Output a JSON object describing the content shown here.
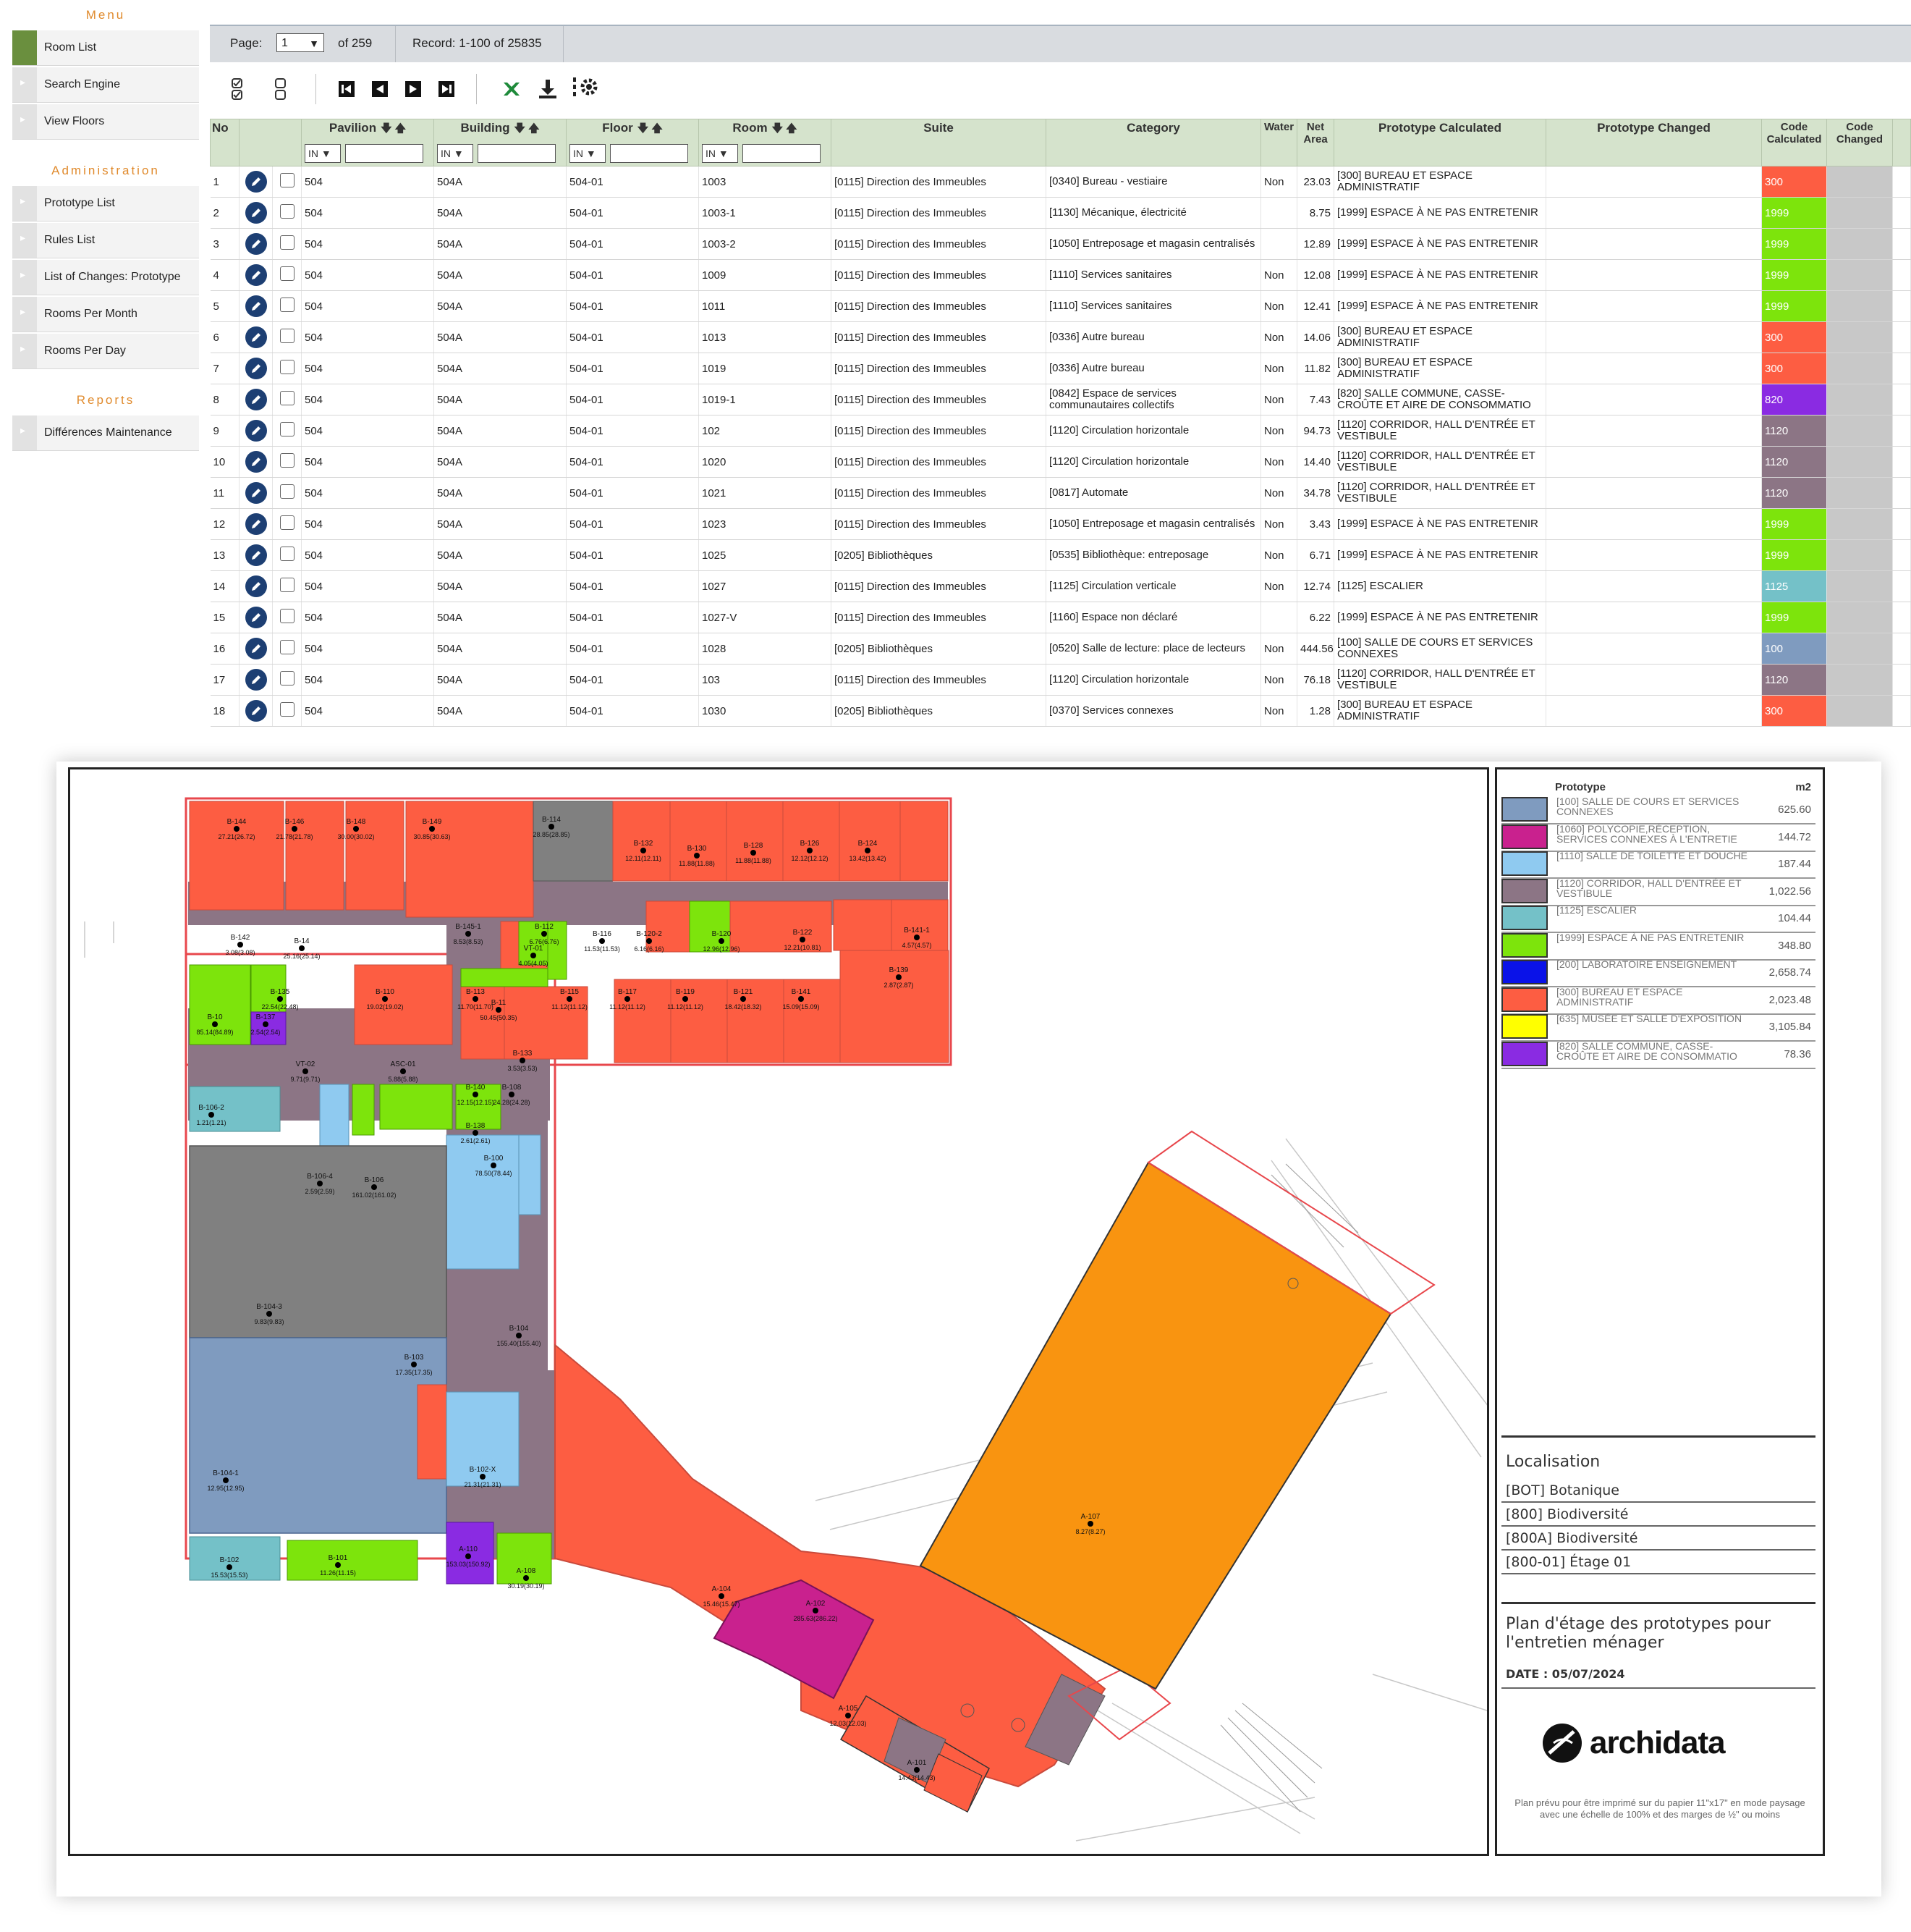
{
  "menu": {
    "heading": "Menu",
    "items": [
      {
        "label": "Room List"
      },
      {
        "label": "Search Engine"
      },
      {
        "label": "View Floors"
      }
    ],
    "admin_heading": "Administration",
    "admin_items": [
      {
        "label": "Prototype List"
      },
      {
        "label": "Rules List"
      },
      {
        "label": "List of Changes: Prototype"
      },
      {
        "label": "Rooms Per Month"
      },
      {
        "label": "Rooms Per Day"
      }
    ],
    "reports_heading": "Reports",
    "reports_items": [
      {
        "label": "Différences Maintenance"
      }
    ]
  },
  "pager": {
    "page_label": "Page:",
    "page_value": "1",
    "of_label": "of 259",
    "record_label": "Record: 1-100 of 25835"
  },
  "toolbar": {
    "icons": [
      "check-all-icon",
      "uncheck-all-icon",
      "first-page-icon",
      "prev-page-icon",
      "next-page-icon",
      "last-page-icon",
      "excel-export-icon",
      "download-icon",
      "column-settings-icon"
    ]
  },
  "table": {
    "headers": {
      "no": "No",
      "pavilion": "Pavilion",
      "building": "Building",
      "floor": "Floor",
      "room": "Room",
      "suite": "Suite",
      "category": "Category",
      "water": "Water",
      "net_area": "Net Area",
      "proto_calc": "Prototype Calculated",
      "proto_changed": "Prototype Changed",
      "code_calc": "Code Calculated",
      "code_changed": "Code Changed"
    },
    "filter_op": "IN",
    "rows": [
      {
        "no": "1",
        "pav": "504",
        "bld": "504A",
        "floor": "504-01",
        "room": "1003",
        "suite": "[0115] Direction des Immeubles",
        "cat": "[0340] Bureau - vestiaire",
        "water": "Non",
        "area": "23.03",
        "proto": "[300] BUREAU ET ESPACE ADMINISTRATIF",
        "code": "300",
        "color": "#fd5d42"
      },
      {
        "no": "2",
        "pav": "504",
        "bld": "504A",
        "floor": "504-01",
        "room": "1003-1",
        "suite": "[0115] Direction des Immeubles",
        "cat": "[1130] Mécanique, électricité",
        "water": "",
        "area": "8.75",
        "proto": "[1999] ESPACE À NE PAS ENTRETENIR",
        "code": "1999",
        "color": "#7de40c"
      },
      {
        "no": "3",
        "pav": "504",
        "bld": "504A",
        "floor": "504-01",
        "room": "1003-2",
        "suite": "[0115] Direction des Immeubles",
        "cat": "[1050] Entreposage et magasin centralisés",
        "water": "",
        "area": "12.89",
        "proto": "[1999] ESPACE À NE PAS ENTRETENIR",
        "code": "1999",
        "color": "#7de40c"
      },
      {
        "no": "4",
        "pav": "504",
        "bld": "504A",
        "floor": "504-01",
        "room": "1009",
        "suite": "[0115] Direction des Immeubles",
        "cat": "[1110] Services sanitaires",
        "water": "Non",
        "area": "12.08",
        "proto": "[1999] ESPACE À NE PAS ENTRETENIR",
        "code": "1999",
        "color": "#7de40c"
      },
      {
        "no": "5",
        "pav": "504",
        "bld": "504A",
        "floor": "504-01",
        "room": "1011",
        "suite": "[0115] Direction des Immeubles",
        "cat": "[1110] Services sanitaires",
        "water": "Non",
        "area": "12.41",
        "proto": "[1999] ESPACE À NE PAS ENTRETENIR",
        "code": "1999",
        "color": "#7de40c"
      },
      {
        "no": "6",
        "pav": "504",
        "bld": "504A",
        "floor": "504-01",
        "room": "1013",
        "suite": "[0115] Direction des Immeubles",
        "cat": "[0336] Autre bureau",
        "water": "Non",
        "area": "14.06",
        "proto": "[300] BUREAU ET ESPACE ADMINISTRATIF",
        "code": "300",
        "color": "#fd5d42"
      },
      {
        "no": "7",
        "pav": "504",
        "bld": "504A",
        "floor": "504-01",
        "room": "1019",
        "suite": "[0115] Direction des Immeubles",
        "cat": "[0336] Autre bureau",
        "water": "Non",
        "area": "11.82",
        "proto": "[300] BUREAU ET ESPACE ADMINISTRATIF",
        "code": "300",
        "color": "#fd5d42"
      },
      {
        "no": "8",
        "pav": "504",
        "bld": "504A",
        "floor": "504-01",
        "room": "1019-1",
        "suite": "[0115] Direction des Immeubles",
        "cat": "[0842] Espace de services communautaires collectifs",
        "water": "Non",
        "area": "7.43",
        "proto": "[820] SALLE COMMUNE, CASSE-CROÛTE ET AIRE DE CONSOMMATIO",
        "code": "820",
        "color": "#8a2be2"
      },
      {
        "no": "9",
        "pav": "504",
        "bld": "504A",
        "floor": "504-01",
        "room": "102",
        "suite": "[0115] Direction des Immeubles",
        "cat": "[1120] Circulation horizontale",
        "water": "Non",
        "area": "94.73",
        "proto": "[1120] CORRIDOR, HALL D'ENTRÉE ET VESTIBULE",
        "code": "1120",
        "color": "#8c7585"
      },
      {
        "no": "10",
        "pav": "504",
        "bld": "504A",
        "floor": "504-01",
        "room": "1020",
        "suite": "[0115] Direction des Immeubles",
        "cat": "[1120] Circulation horizontale",
        "water": "Non",
        "area": "14.40",
        "proto": "[1120] CORRIDOR, HALL D'ENTRÉE ET VESTIBULE",
        "code": "1120",
        "color": "#8c7585"
      },
      {
        "no": "11",
        "pav": "504",
        "bld": "504A",
        "floor": "504-01",
        "room": "1021",
        "suite": "[0115] Direction des Immeubles",
        "cat": "[0817] Automate",
        "water": "Non",
        "area": "34.78",
        "proto": "[1120] CORRIDOR, HALL D'ENTRÉE ET VESTIBULE",
        "code": "1120",
        "color": "#8c7585"
      },
      {
        "no": "12",
        "pav": "504",
        "bld": "504A",
        "floor": "504-01",
        "room": "1023",
        "suite": "[0115] Direction des Immeubles",
        "cat": "[1050] Entreposage et magasin centralisés",
        "water": "Non",
        "area": "3.43",
        "proto": "[1999] ESPACE À NE PAS ENTRETENIR",
        "code": "1999",
        "color": "#7de40c"
      },
      {
        "no": "13",
        "pav": "504",
        "bld": "504A",
        "floor": "504-01",
        "room": "1025",
        "suite": "[0205] Bibliothèques",
        "cat": "[0535] Bibliothèque: entreposage",
        "water": "Non",
        "area": "6.71",
        "proto": "[1999] ESPACE À NE PAS ENTRETENIR",
        "code": "1999",
        "color": "#7de40c"
      },
      {
        "no": "14",
        "pav": "504",
        "bld": "504A",
        "floor": "504-01",
        "room": "1027",
        "suite": "[0115] Direction des Immeubles",
        "cat": "[1125] Circulation verticale",
        "water": "Non",
        "area": "12.74",
        "proto": "[1125] ESCALIER",
        "code": "1125",
        "color": "#74c1c8"
      },
      {
        "no": "15",
        "pav": "504",
        "bld": "504A",
        "floor": "504-01",
        "room": "1027-V",
        "suite": "[0115] Direction des Immeubles",
        "cat": "[1160] Espace non déclaré",
        "water": "",
        "area": "6.22",
        "proto": "[1999] ESPACE À NE PAS ENTRETENIR",
        "code": "1999",
        "color": "#7de40c"
      },
      {
        "no": "16",
        "pav": "504",
        "bld": "504A",
        "floor": "504-01",
        "room": "1028",
        "suite": "[0205] Bibliothèques",
        "cat": "[0520] Salle de lecture: place de lecteurs",
        "water": "Non",
        "area": "444.56",
        "proto": "[100] SALLE DE COURS ET SERVICES CONNEXES",
        "code": "100",
        "color": "#7f9bbf"
      },
      {
        "no": "17",
        "pav": "504",
        "bld": "504A",
        "floor": "504-01",
        "room": "103",
        "suite": "[0115] Direction des Immeubles",
        "cat": "[1120] Circulation horizontale",
        "water": "Non",
        "area": "76.18",
        "proto": "[1120] CORRIDOR, HALL D'ENTRÉE ET VESTIBULE",
        "code": "1120",
        "color": "#8c7585"
      },
      {
        "no": "18",
        "pav": "504",
        "bld": "504A",
        "floor": "504-01",
        "room": "1030",
        "suite": "[0205] Bibliothèques",
        "cat": "[0370] Services connexes",
        "water": "Non",
        "area": "1.28",
        "proto": "[300] BUREAU ET ESPACE ADMINISTRATIF",
        "code": "300",
        "color": "#fd5d42"
      }
    ]
  },
  "plan": {
    "room_labels": [
      {
        "id": "B-144",
        "area": "27.21(26.72)"
      },
      {
        "id": "B-146",
        "area": "21.78(21.78)"
      },
      {
        "id": "B-148",
        "area": "30.00(30.02)"
      },
      {
        "id": "B-149",
        "area": "30.85(30.63)"
      },
      {
        "id": "B-114",
        "area": "28.85(28.85)"
      },
      {
        "id": "B-132",
        "area": "12.11(12.11)"
      },
      {
        "id": "B-130",
        "area": "11.88(11.88)"
      },
      {
        "id": "B-128",
        "area": "11.88(11.88)"
      },
      {
        "id": "B-126",
        "area": "12.12(12.12)"
      },
      {
        "id": "B-124",
        "area": "13.42(13.42)"
      },
      {
        "id": "B-142",
        "area": "3.08(3.08)"
      },
      {
        "id": "B-14",
        "area": "25.16(25.14)"
      },
      {
        "id": "B-145-1",
        "area": "8.53(8.53)"
      },
      {
        "id": "B-112",
        "area": "6.76(6.76)"
      },
      {
        "id": "VT-01",
        "area": "4.05(4.05)"
      },
      {
        "id": "B-116",
        "area": "11.53(11.53)"
      },
      {
        "id": "B-120-2",
        "area": "6.16(6.16)"
      },
      {
        "id": "B-120",
        "area": "12.96(12.96)"
      },
      {
        "id": "B-122",
        "area": "12.21(10.81)"
      },
      {
        "id": "B-141-1",
        "area": "4.57(4.57)"
      },
      {
        "id": "B-135",
        "area": "22.54(22.48)"
      },
      {
        "id": "B-110",
        "area": "19.02(19.02)"
      },
      {
        "id": "B-11",
        "area": "50.45(50.35)"
      },
      {
        "id": "B-113",
        "area": "11.70(11.70)"
      },
      {
        "id": "B-115",
        "area": "11.12(11.12)"
      },
      {
        "id": "B-117",
        "area": "11.12(11.12)"
      },
      {
        "id": "B-119",
        "area": "11.12(11.12)"
      },
      {
        "id": "B-121",
        "area": "18.42(18.32)"
      },
      {
        "id": "B-141",
        "area": "15.09(15.09)"
      },
      {
        "id": "B-139",
        "area": "2.87(2.87)"
      },
      {
        "id": "B-10",
        "area": "85.14(84.89)"
      },
      {
        "id": "B-137",
        "area": "2.54(2.54)"
      },
      {
        "id": "B-133",
        "area": "3.53(3.53)"
      },
      {
        "id": "VT-02",
        "area": "9.71(9.71)"
      },
      {
        "id": "ASC-01",
        "area": "5.88(5.88)"
      },
      {
        "id": "B-140",
        "area": "12.15(12.15)"
      },
      {
        "id": "B-108",
        "area": "24.28(24.28)"
      },
      {
        "id": "B-106-2",
        "area": "1.21(1.21)"
      },
      {
        "id": "B-138",
        "area": "2.61(2.61)"
      },
      {
        "id": "B-106-4",
        "area": "2.59(2.59)"
      },
      {
        "id": "B-106",
        "area": "161.02(161.02)"
      },
      {
        "id": "B-100",
        "area": "78.50(78.44)"
      },
      {
        "id": "B-104-3",
        "area": "9.83(9.83)"
      },
      {
        "id": "B-104",
        "area": "155.40(155.40)"
      },
      {
        "id": "B-103",
        "area": "17.35(17.35)"
      },
      {
        "id": "B-104-1",
        "area": "12.95(12.95)"
      },
      {
        "id": "B-102-X",
        "area": "21.31(21.31)"
      },
      {
        "id": "B-102",
        "area": "15.53(15.53)"
      },
      {
        "id": "B-101",
        "area": "11.26(11.15)"
      },
      {
        "id": "A-110",
        "area": "153.03(150.92)"
      },
      {
        "id": "A-108",
        "area": "30.19(30.19)"
      },
      {
        "id": "A-102",
        "area": "285.63(286.22)"
      },
      {
        "id": "A-104",
        "area": "15.46(15.47)"
      },
      {
        "id": "A-107",
        "area": "8.27(8.27)"
      },
      {
        "id": "A-105",
        "area": "12.03(12.03)"
      },
      {
        "id": "A-101",
        "area": "14.43(14.43)"
      }
    ]
  },
  "legend": {
    "title": "Prototype",
    "unit": "m2",
    "items": [
      {
        "label": "[100] SALLE DE COURS ET SERVICES CONNEXES",
        "value": "625.60",
        "color": "#7f9bbf"
      },
      {
        "label": "[1060] POLYCOPIE,RÉCEPTION, SERVICES CONNEXES À L'ENTRETIE",
        "value": "144.72",
        "color": "#c9218e"
      },
      {
        "label": "[1110] SALLE DE TOILETTE ET DOUCHE",
        "value": "187.44",
        "color": "#8fcaf0"
      },
      {
        "label": "[1120] CORRIDOR, HALL D'ENTRÉE ET VESTIBULE",
        "value": "1,022.56",
        "color": "#8c7585"
      },
      {
        "label": "[1125] ESCALIER",
        "value": "104.44",
        "color": "#74c1c8"
      },
      {
        "label": "[1999] ESPACE À NE PAS ENTRETENIR",
        "value": "348.80",
        "color": "#7de40c"
      },
      {
        "label": "[200] LABORATOIRE ENSEIGNEMENT",
        "value": "2,658.74",
        "color": "#0a12e8"
      },
      {
        "label": "[300] BUREAU ET ESPACE ADMINISTRATIF",
        "value": "2,023.48",
        "color": "#fd5d42"
      },
      {
        "label": "[635] MUSÉE ET SALLE D'EXPOSITION",
        "value": "3,105.84",
        "color": "#ffff00"
      },
      {
        "label": "[820] SALLE COMMUNE, CASSE-CROÛTE ET AIRE DE CONSOMMATIO",
        "value": "78.36",
        "color": "#8a2be2"
      }
    ],
    "localisation_title": "Localisation",
    "localisation": [
      "[BOT] Botanique",
      "[800] Biodiversité",
      "[800A] Biodiversité",
      "[800-01] Étage 01"
    ],
    "plan_title": "Plan d'étage des prototypes pour l'entretien ménager",
    "date": "DATE : 05/07/2024",
    "brand": "archidata",
    "footnote": "Plan prévu pour être imprimé sur du papier 11\"x17\" en mode paysage avec une échelle de 100% et des marges de ½\" ou moins"
  }
}
